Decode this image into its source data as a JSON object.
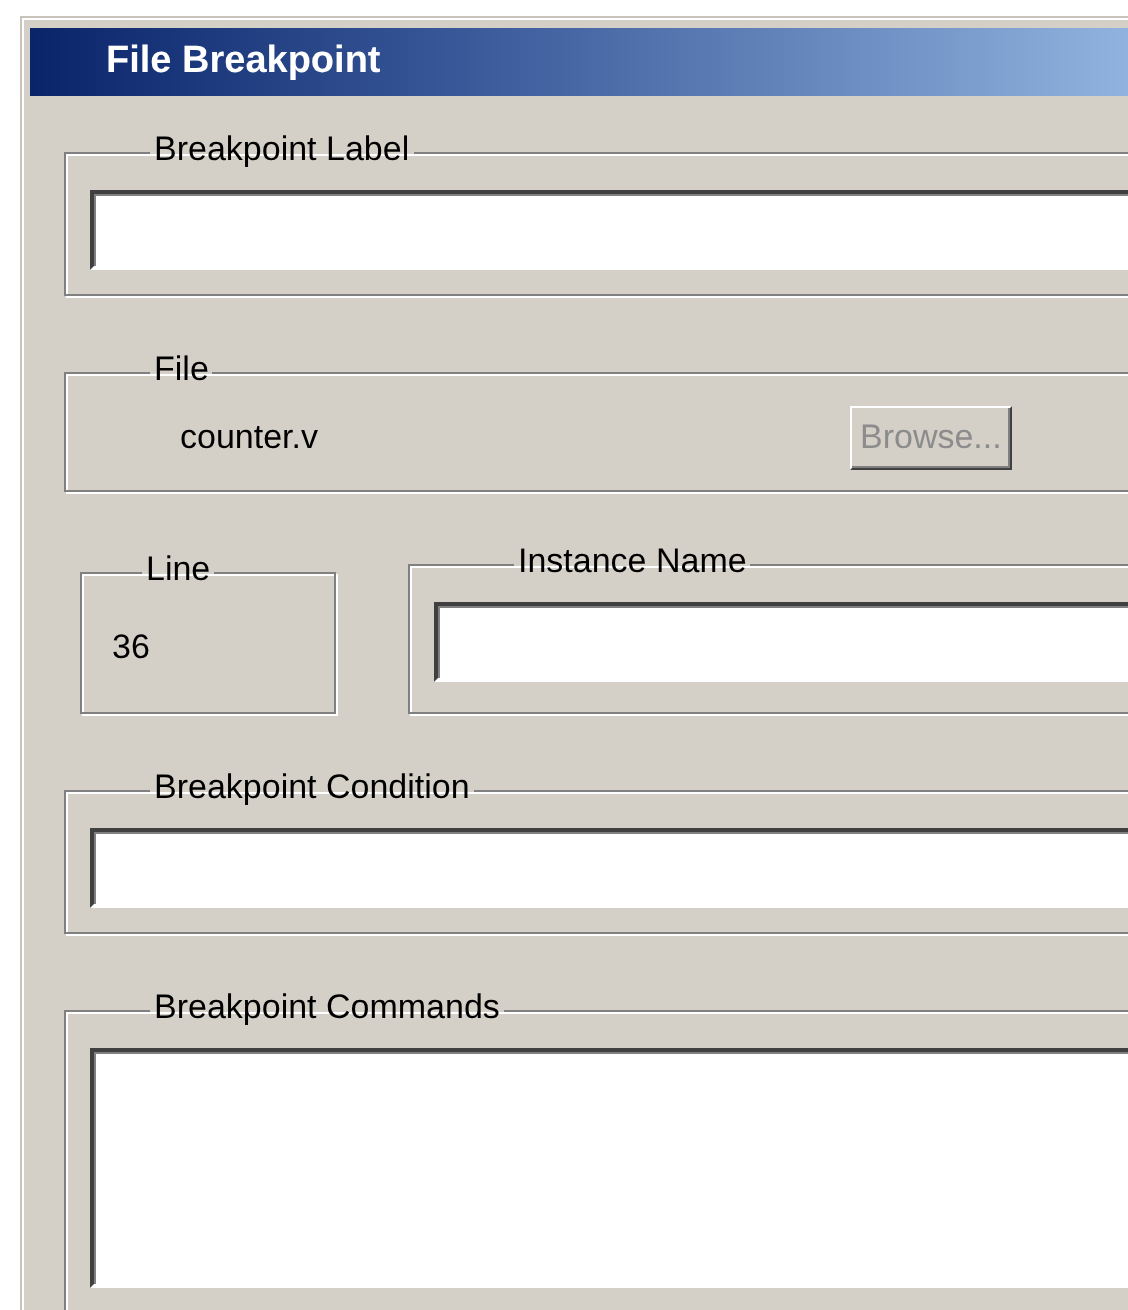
{
  "window": {
    "title": "File Breakpoint"
  },
  "breakpoint_label": {
    "legend": "Breakpoint Label"
  },
  "file": {
    "legend": "File",
    "filename": "counter.v",
    "browse_button": {
      "label": "Browse...",
      "disabled": true
    }
  },
  "line": {
    "legend": "Line",
    "value": "36"
  },
  "instance_name": {
    "legend": "Instance Name"
  },
  "breakpoint_condition": {
    "legend": "Breakpoint Condition"
  },
  "breakpoint_commands": {
    "legend": "Breakpoint Commands"
  }
}
